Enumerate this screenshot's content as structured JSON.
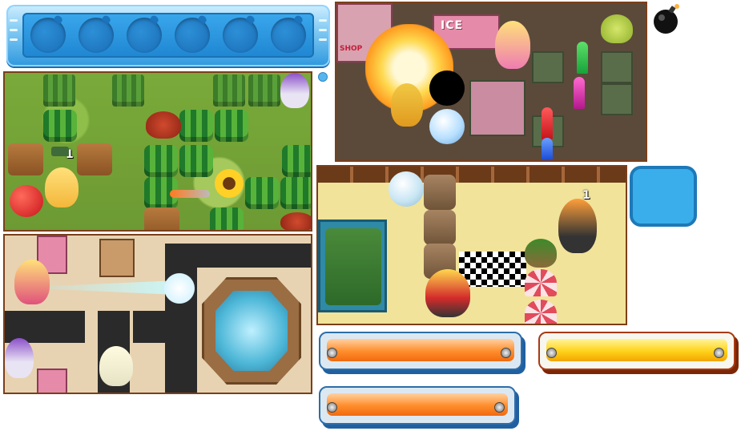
{
  "slot_bar": {
    "slot_count": 6,
    "color": "#2f98de"
  },
  "scene_farm": {
    "player_bomb_count": "1",
    "icons": [
      "watermelon-crate-icon",
      "apple-icon",
      "sunflower-icon",
      "rocket-icon"
    ]
  },
  "scene_city": {
    "shop_sign": "ICE",
    "shop_label": "SHOP",
    "icons": [
      "firework-rocket-icon",
      "bomb-character-icon"
    ]
  },
  "scene_mall": {
    "icons": [
      "fountain-icon",
      "water-jet-icon"
    ]
  },
  "scene_race": {
    "opponent_bomb_count": "1",
    "icons": [
      "checkered-flag-icon",
      "umbrella-icon"
    ]
  },
  "progress_bars": [
    {
      "id": "orange-bar-1",
      "color": "#ff8e2c"
    },
    {
      "id": "yellow-bar",
      "color": "#ffd21a"
    },
    {
      "id": "orange-bar-2",
      "color": "#ff8e2c"
    }
  ],
  "colors": {
    "accent_blue": "#3aaeea",
    "frame_brown": "#7a3f1b"
  }
}
